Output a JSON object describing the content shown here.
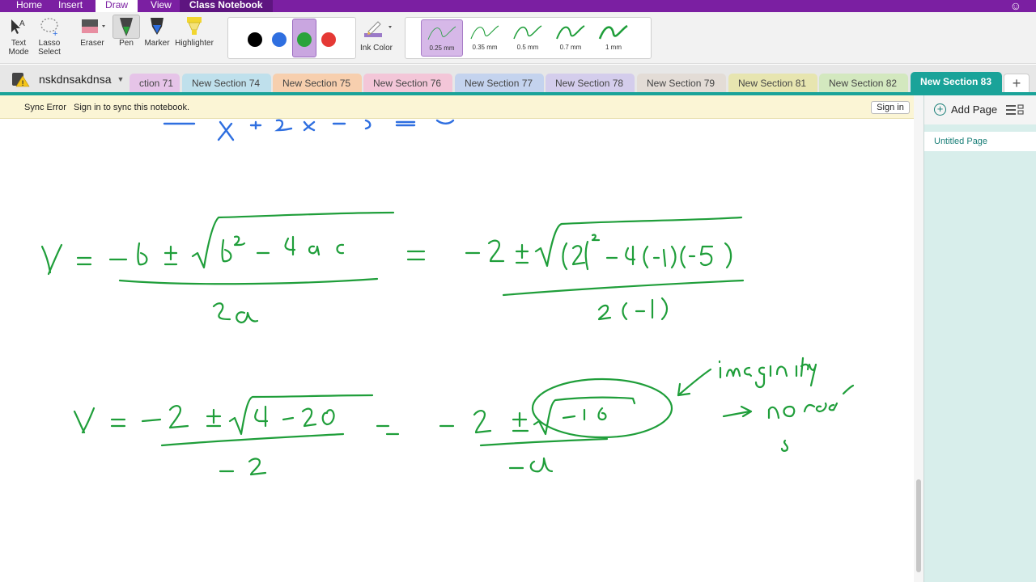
{
  "menubar": {
    "items": [
      "Home",
      "Insert",
      "Draw",
      "View",
      "Class Notebook"
    ],
    "active": "Draw"
  },
  "ribbon": {
    "text_mode": "Text Mode",
    "lasso_select": "Lasso Select",
    "eraser": "Eraser",
    "pen": "Pen",
    "marker": "Marker",
    "highlighter": "Highlighter",
    "ink_color": "Ink Color",
    "colors": [
      "#000000",
      "#2f6fe0",
      "#2aa33a",
      "#e53935"
    ],
    "selected_color": "#2aa33a",
    "thicknesses": [
      "0.25 mm",
      "0.35 mm",
      "0.5 mm",
      "0.7 mm",
      "1 mm"
    ],
    "selected_thickness": "0.25 mm"
  },
  "notebook": {
    "name": "nskdnsakdnsa",
    "sections": [
      {
        "label": "ction 71",
        "color": "#e6c4e8"
      },
      {
        "label": "New Section 74",
        "color": "#bfe0ec"
      },
      {
        "label": "New Section 75",
        "color": "#f7cfae"
      },
      {
        "label": "New Section 76",
        "color": "#f3c6d8"
      },
      {
        "label": "New Section 77",
        "color": "#c4d3ee"
      },
      {
        "label": "New Section 78",
        "color": "#d4cdec"
      },
      {
        "label": "New Section 79",
        "color": "#e3dcd6"
      },
      {
        "label": "New Section 81",
        "color": "#e7e5b0"
      },
      {
        "label": "New Section 82",
        "color": "#d3e8bf"
      },
      {
        "label": "New Section 83",
        "color": "#1aa399"
      }
    ],
    "active_section": "New Section 83"
  },
  "sync": {
    "title": "Sync Error",
    "message": "Sign in to sync this notebook.",
    "button": "Sign in"
  },
  "pages": {
    "add_label": "Add Page",
    "items": [
      "Untitled Page"
    ]
  },
  "ink": {
    "blue": "#2f6fe0",
    "green": "#1f9e3a"
  }
}
